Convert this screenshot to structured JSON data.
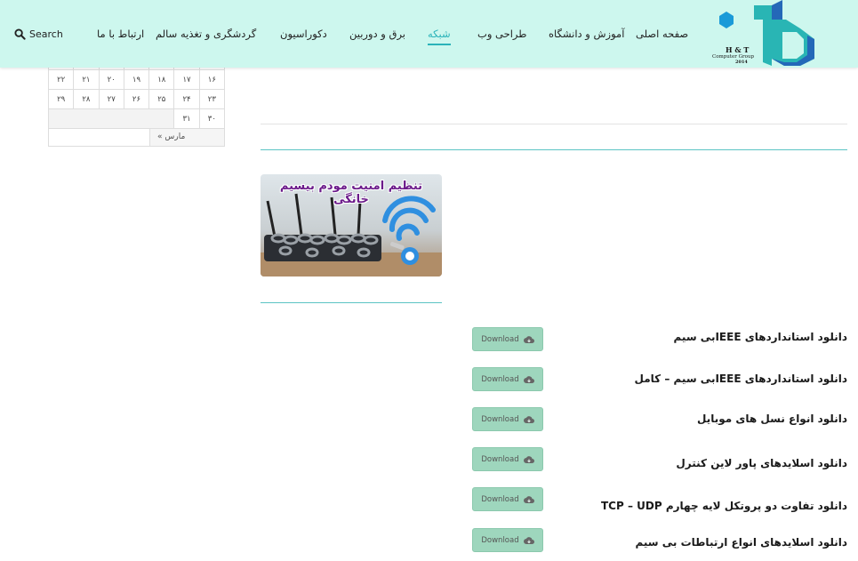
{
  "header": {
    "search_label": "Search",
    "nav_items": [
      {
        "label": "صفحه اصلی"
      },
      {
        "label": "آموزش و دانشگاه"
      },
      {
        "label": "طراحی وب"
      },
      {
        "label": "شبکه",
        "active": true
      },
      {
        "label": "برق و دوربین"
      },
      {
        "label": "دکوراسیون"
      },
      {
        "label": "گردشگری و تغذیه سالم"
      },
      {
        "label": "ارتباط با ما"
      }
    ],
    "logo": {
      "line1": "H & T",
      "line2": "Computer Group",
      "line3": "2014",
      "colors": [
        "#1a9ad8",
        "#29b5b4",
        "#2468b8"
      ]
    },
    "accent_color": "#2ab3b9",
    "background_color": "#cdf7ee"
  },
  "calendar": {
    "rows": [
      [
        "۲۲",
        "۲۱",
        "۲۰",
        "۱۹",
        "۱۸",
        "۱۷",
        "۱۶"
      ],
      [
        "۲۹",
        "۲۸",
        "۲۷",
        "۲۶",
        "۲۵",
        "۲۴",
        "۲۳"
      ],
      [
        "",
        "",
        "",
        "",
        "",
        "۳۱",
        "۳۰"
      ]
    ],
    "prev_month_label": "« مارس"
  },
  "featured": {
    "image_title": "تنظیم امنیت مودم بیسیم خانگی",
    "image_icon": "wifi-lock-router-icon"
  },
  "downloads": {
    "button_label": "Download",
    "button_icon": "cloud-download-icon",
    "button_color": "#9ed6bd",
    "items": [
      {
        "title": "دانلود استانداردهای IEEEبی سیم"
      },
      {
        "title": "دانلود استانداردهای IEEEبی سیم – کامل"
      },
      {
        "title": "دانلود انواع نسل های موبایل"
      },
      {
        "title": "دانلود اسلایدهای پاور لاین کنترل"
      },
      {
        "title": "دانلود تفاوت دو پروتکل لایه چهارم TCP – UDP"
      },
      {
        "title": "دانلود اسلایدهای انواع ارتباطات بی سیم"
      }
    ]
  }
}
